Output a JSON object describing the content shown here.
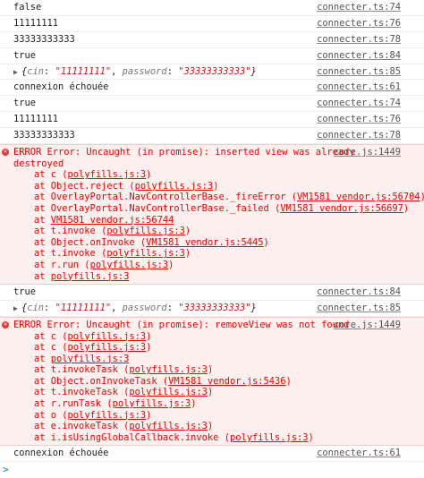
{
  "logs": [
    {
      "text": "false",
      "source": "connecter.ts:74"
    },
    {
      "text": "11111111",
      "source": "connecter.ts:76"
    },
    {
      "text": "33333333333",
      "source": "connecter.ts:78"
    },
    {
      "text": "true",
      "source": "connecter.ts:84"
    },
    {
      "object": {
        "open": "{",
        "k1": "cin",
        "v1": "\"11111111\"",
        "sep": ", ",
        "k2": "password",
        "v2": "\"33333333333\"",
        "close": "}"
      },
      "source": "connecter.ts:85"
    },
    {
      "text": "connexion échouée",
      "source": "connecter.ts:61"
    },
    {
      "text": "true",
      "source": "connecter.ts:74"
    },
    {
      "text": "11111111",
      "source": "connecter.ts:76"
    },
    {
      "text": "33333333333",
      "source": "connecter.ts:78"
    },
    {
      "text": "true",
      "source": "connecter.ts:84"
    },
    {
      "object": {
        "open": "{",
        "k1": "cin",
        "v1": "\"11111111\"",
        "sep": ", ",
        "k2": "password",
        "v2": "\"33333333333\"",
        "close": "}"
      },
      "source": "connecter.ts:85"
    },
    {
      "text": "connexion échouée",
      "source": "connecter.ts:61"
    }
  ],
  "errors": [
    {
      "source": "core.js:1449",
      "message": "ERROR Error: Uncaught (in promise): inserted view was already",
      "message2": "destroyed",
      "stack": [
        {
          "pre": "at c (",
          "link": "polyfills.js:3",
          "post": ")"
        },
        {
          "pre": "at Object.reject (",
          "link": "polyfills.js:3",
          "post": ")"
        },
        {
          "pre": "at OverlayPortal.NavControllerBase._fireError (",
          "link": "VM1581 vendor.js:56704",
          "post": ")"
        },
        {
          "pre": "at OverlayPortal.NavControllerBase._failed (",
          "link": "VM1581 vendor.js:56697",
          "post": ")"
        },
        {
          "pre": "at ",
          "link": "VM1581 vendor.js:56744",
          "post": ""
        },
        {
          "pre": "at t.invoke (",
          "link": "polyfills.js:3",
          "post": ")"
        },
        {
          "pre": "at Object.onInvoke (",
          "link": "VM1581 vendor.js:5445",
          "post": ")"
        },
        {
          "pre": "at t.invoke (",
          "link": "polyfills.js:3",
          "post": ")"
        },
        {
          "pre": "at r.run (",
          "link": "polyfills.js:3",
          "post": ")"
        },
        {
          "pre": "at ",
          "link": "polyfills.js:3",
          "post": ""
        }
      ]
    },
    {
      "source": "core.js:1449",
      "message": "ERROR Error: Uncaught (in promise): removeView was not found",
      "stack": [
        {
          "pre": "at c (",
          "link": "polyfills.js:3",
          "post": ")"
        },
        {
          "pre": "at c (",
          "link": "polyfills.js:3",
          "post": ")"
        },
        {
          "pre": "at ",
          "link": "polyfills.js:3",
          "post": ""
        },
        {
          "pre": "at t.invokeTask (",
          "link": "polyfills.js:3",
          "post": ")"
        },
        {
          "pre": "at Object.onInvokeTask (",
          "link": "VM1581 vendor.js:5436",
          "post": ")"
        },
        {
          "pre": "at t.invokeTask (",
          "link": "polyfills.js:3",
          "post": ")"
        },
        {
          "pre": "at r.runTask (",
          "link": "polyfills.js:3",
          "post": ")"
        },
        {
          "pre": "at o (",
          "link": "polyfills.js:3",
          "post": ")"
        },
        {
          "pre": "at e.invokeTask (",
          "link": "polyfills.js:3",
          "post": ")"
        },
        {
          "pre": "at i.isUsingGlobalCallback.invoke (",
          "link": "polyfills.js:3",
          "post": ")"
        }
      ]
    }
  ],
  "prompt": ">"
}
